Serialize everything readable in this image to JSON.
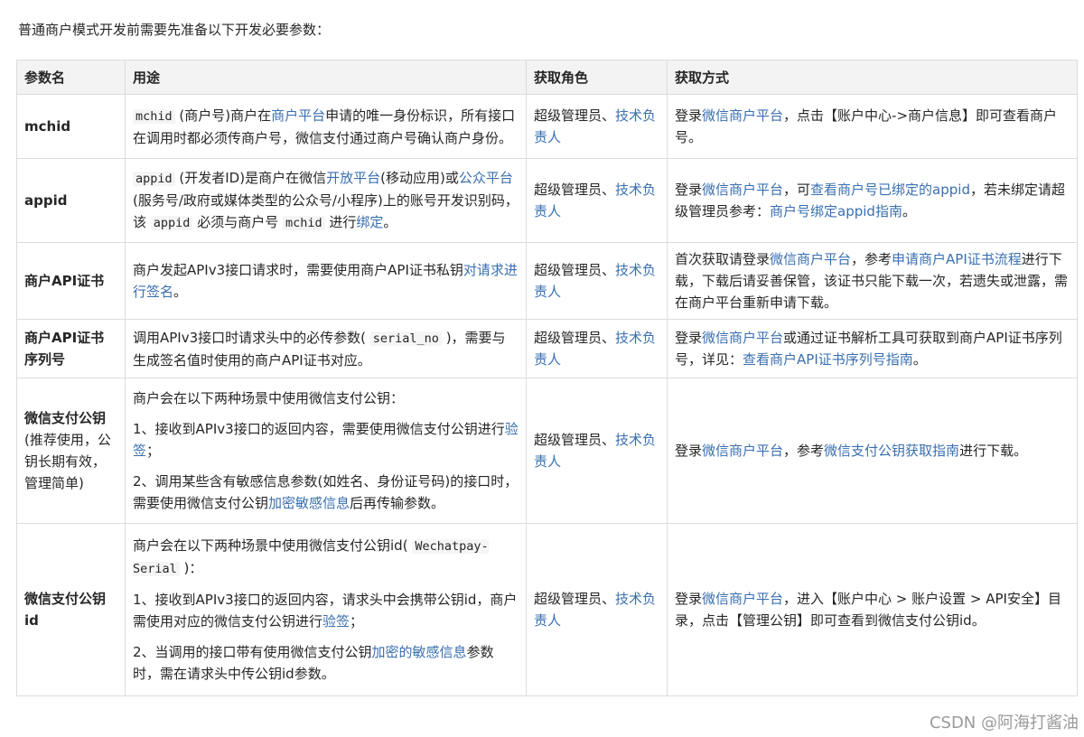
{
  "intro": "普通商户模式开发前需要先准备以下开发必要参数：",
  "table": {
    "headers": [
      "参数名",
      "用途",
      "获取角色",
      "获取方式"
    ],
    "roles": {
      "plain": "超级管理员、",
      "link": "技术负责人"
    },
    "rows": [
      {
        "name": "mchid",
        "usage": {
          "code1": "mchid",
          "t1": " (商户号)商户在",
          "l1": "商户平台",
          "t2": "申请的唯一身份标识，所有接口在调用时都必须传商户号，微信支付通过商户号确认商户身份。"
        },
        "method": {
          "t1": "登录",
          "l1": "微信商户平台",
          "t2": "，点击【账户中心->商户信息】即可查看商户号。"
        }
      },
      {
        "name": "appid",
        "usage": {
          "code1": "appid",
          "t1": " (开发者ID)是商户在微信",
          "l1": "开放平台",
          "t2": "(移动应用)或",
          "l2": "公众平台",
          "t3": "(服务号/政府或媒体类型的公众号/小程序)上的账号开发识别码，该 ",
          "code2": "appid",
          "t4": " 必须与商户号 ",
          "code3": "mchid",
          "t5": " 进行",
          "l3": "绑定",
          "t6": "。"
        },
        "method": {
          "t1": "登录",
          "l1": "微信商户平台",
          "t2": "，可",
          "l2": "查看商户号已绑定的appid",
          "t3": "，若未绑定请超级管理员参考：",
          "l3": "商户号绑定appid指南",
          "t4": "。"
        }
      },
      {
        "name": "商户API证书",
        "usage": {
          "t1": "商户发起APIv3接口请求时，需要使用商户API证书私钥",
          "l1": "对请求进行签名",
          "t2": "。"
        },
        "method": {
          "t1": "首次获取请登录",
          "l1": "微信商户平台",
          "t2": "，参考",
          "l2": "申请商户API证书流程",
          "t3": "进行下载，下载后请妥善保管，该证书只能下载一次，若遗失或泄露，需在商户平台重新申请下载。"
        }
      },
      {
        "name": "商户API证书序列号",
        "usage": {
          "t1": "调用APIv3接口时请求头中的必传参数( ",
          "code1": "serial_no",
          "t2": " )，需要与生成签名值时使用的商户API证书对应。"
        },
        "method": {
          "t1": "登录",
          "l1": "微信商户平台",
          "t2": "或通过证书解析工具可获取到商户API证书序列号，详见：",
          "l2": "查看商户API证书序列号指南",
          "t3": "。"
        }
      },
      {
        "name": "微信支付公钥",
        "name_sub": "(推荐使用，公钥长期有效，管理简单)",
        "usage": {
          "p1": "商户会在以下两种场景中使用微信支付公钥：",
          "p2_t1": "1、接收到APIv3接口的返回内容，需要使用微信支付公钥进行",
          "p2_l1": "验签",
          "p2_t2": "；",
          "p3_t1": "2、调用某些含有敏感信息参数(如姓名、身份证号码)的接口时，需要使用微信支付公钥",
          "p3_l1": "加密敏感信息",
          "p3_t2": "后再传输参数。"
        },
        "method": {
          "t1": "登录",
          "l1": "微信商户平台",
          "t2": "，参考",
          "l2": "微信支付公钥获取指南",
          "t3": "进行下载。"
        }
      },
      {
        "name": "微信支付公钥id",
        "usage": {
          "p1_t1": "商户会在以下两种场景中使用微信支付公钥id( ",
          "p1_code": "Wechatpay-Serial",
          "p1_t2": " )：",
          "p2_t1": "1、接收到APIv3接口的返回内容，请求头中会携带公钥id，商户需使用对应的微信支付公钥进行",
          "p2_l1": "验签",
          "p2_t2": "；",
          "p3_t1": "2、当调用的接口带有使用微信支付公钥",
          "p3_l1": "加密的敏感信息",
          "p3_t2": "参数时，需在请求头中传公钥id参数。"
        },
        "method": {
          "t1": "登录",
          "l1": "微信商户平台",
          "t2": "，进入【账户中心 > 账户设置 > API安全】目录，点击【管理公钥】即可查看到微信支付公钥id。"
        }
      }
    ]
  },
  "watermark": "CSDN @阿海打酱油"
}
